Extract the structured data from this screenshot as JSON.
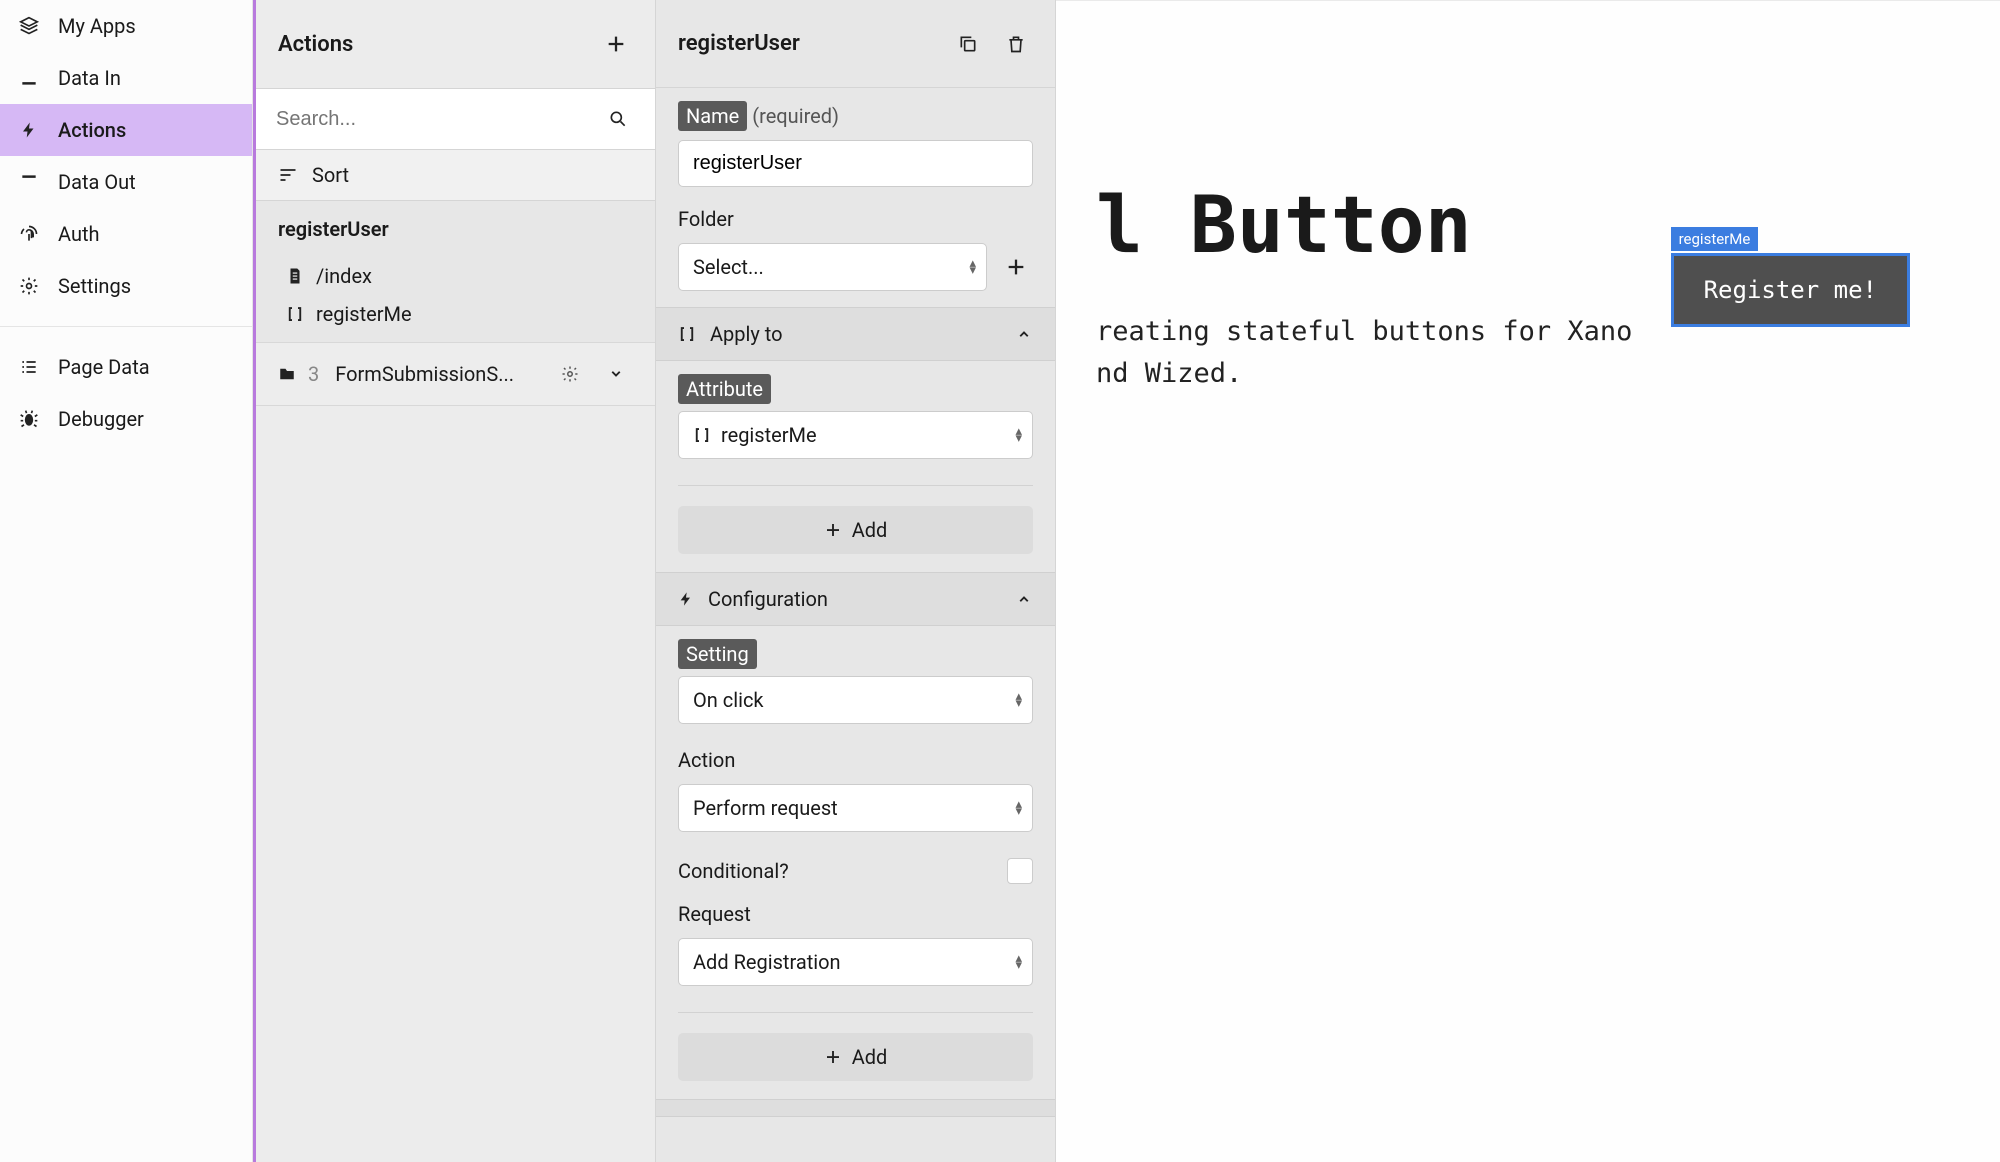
{
  "sidebar": {
    "items": [
      {
        "label": "My Apps",
        "icon": "layers-icon"
      },
      {
        "label": "Data In",
        "icon": "download-icon"
      },
      {
        "label": "Actions",
        "icon": "bolt-icon",
        "active": true
      },
      {
        "label": "Data Out",
        "icon": "upload-icon"
      },
      {
        "label": "Auth",
        "icon": "fingerprint-icon"
      },
      {
        "label": "Settings",
        "icon": "gear-icon"
      }
    ],
    "secondary": [
      {
        "label": "Page Data",
        "icon": "list-icon"
      },
      {
        "label": "Debugger",
        "icon": "bug-icon"
      }
    ]
  },
  "actions": {
    "title": "Actions",
    "search_placeholder": "Search...",
    "sort_label": "Sort",
    "selected": {
      "name": "registerUser",
      "page": "/index",
      "attr": "registerMe"
    },
    "folder": {
      "count": "3",
      "name": "FormSubmissionS..."
    }
  },
  "details": {
    "title": "registerUser",
    "name_chip": "Name",
    "name_required": "(required)",
    "name_value": "registerUser",
    "folder_label": "Folder",
    "folder_select": "Select...",
    "apply_to": "Apply to",
    "attribute_chip": "Attribute",
    "attribute_value": "registerMe",
    "add_label": "Add",
    "configuration": "Configuration",
    "setting_chip": "Setting",
    "setting_value": "On click",
    "action_label": "Action",
    "action_value": "Perform request",
    "conditional_label": "Conditional?",
    "request_label": "Request",
    "request_value": "Add Registration"
  },
  "preview": {
    "title_fragment": "l Button",
    "sub_line1": "reating stateful buttons for Xano",
    "sub_line2": "nd Wized.",
    "tag": "registerMe",
    "button": "Register me!"
  }
}
